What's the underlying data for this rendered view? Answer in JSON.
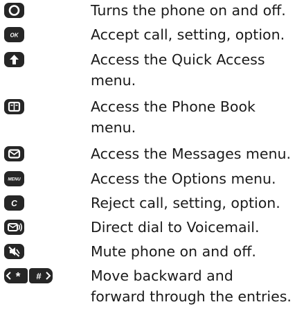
{
  "keys": [
    {
      "icon": "power-key-icon",
      "description": "Turns the phone on and off."
    },
    {
      "icon": "ok-key-icon",
      "description": "Accept call, setting, option."
    },
    {
      "icon": "up-arrow-key-icon",
      "description": "Access the Quick Access menu."
    },
    {
      "icon": "phone-book-key-icon",
      "description": "Access the Phone Book menu."
    },
    {
      "icon": "messages-key-icon",
      "description": "Access the Messages menu."
    },
    {
      "icon": "menu-key-icon",
      "description": "Access the Options menu."
    },
    {
      "icon": "c-key-icon",
      "description": "Reject call, setting, option."
    },
    {
      "icon": "voicemail-key-icon",
      "description": "Direct dial to Voicemail."
    },
    {
      "icon": "mute-key-icon",
      "description": "Mute phone on and off."
    },
    {
      "icon": "star-hash-keys-icon",
      "description": "Move backward and forward through the entries."
    }
  ],
  "labels": {
    "ok": "OK",
    "menu": "MENU",
    "c": "C",
    "star": "*",
    "hash": "#"
  },
  "colors": {
    "key_fill": "#262626",
    "key_glyph": "#ffffff",
    "text": "#1a1a1a"
  }
}
